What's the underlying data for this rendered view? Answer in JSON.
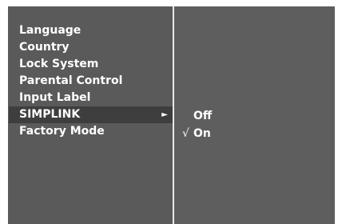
{
  "menu": {
    "items": [
      {
        "label": "Language"
      },
      {
        "label": "Country"
      },
      {
        "label": "Lock System"
      },
      {
        "label": "Parental Control"
      },
      {
        "label": "Input Label"
      },
      {
        "label": "SIMPLINK",
        "selected": true
      },
      {
        "label": "Factory Mode"
      }
    ],
    "submenu_arrow": "►"
  },
  "submenu": {
    "options": [
      {
        "label": "Off",
        "checked": false
      },
      {
        "label": "On",
        "checked": true
      }
    ],
    "check_mark": "√"
  },
  "colors": {
    "panel_background": "#5a5a5a",
    "selected_background": "#3e3e3e",
    "divider": "#e8e8e8",
    "text": "#ffffff"
  }
}
